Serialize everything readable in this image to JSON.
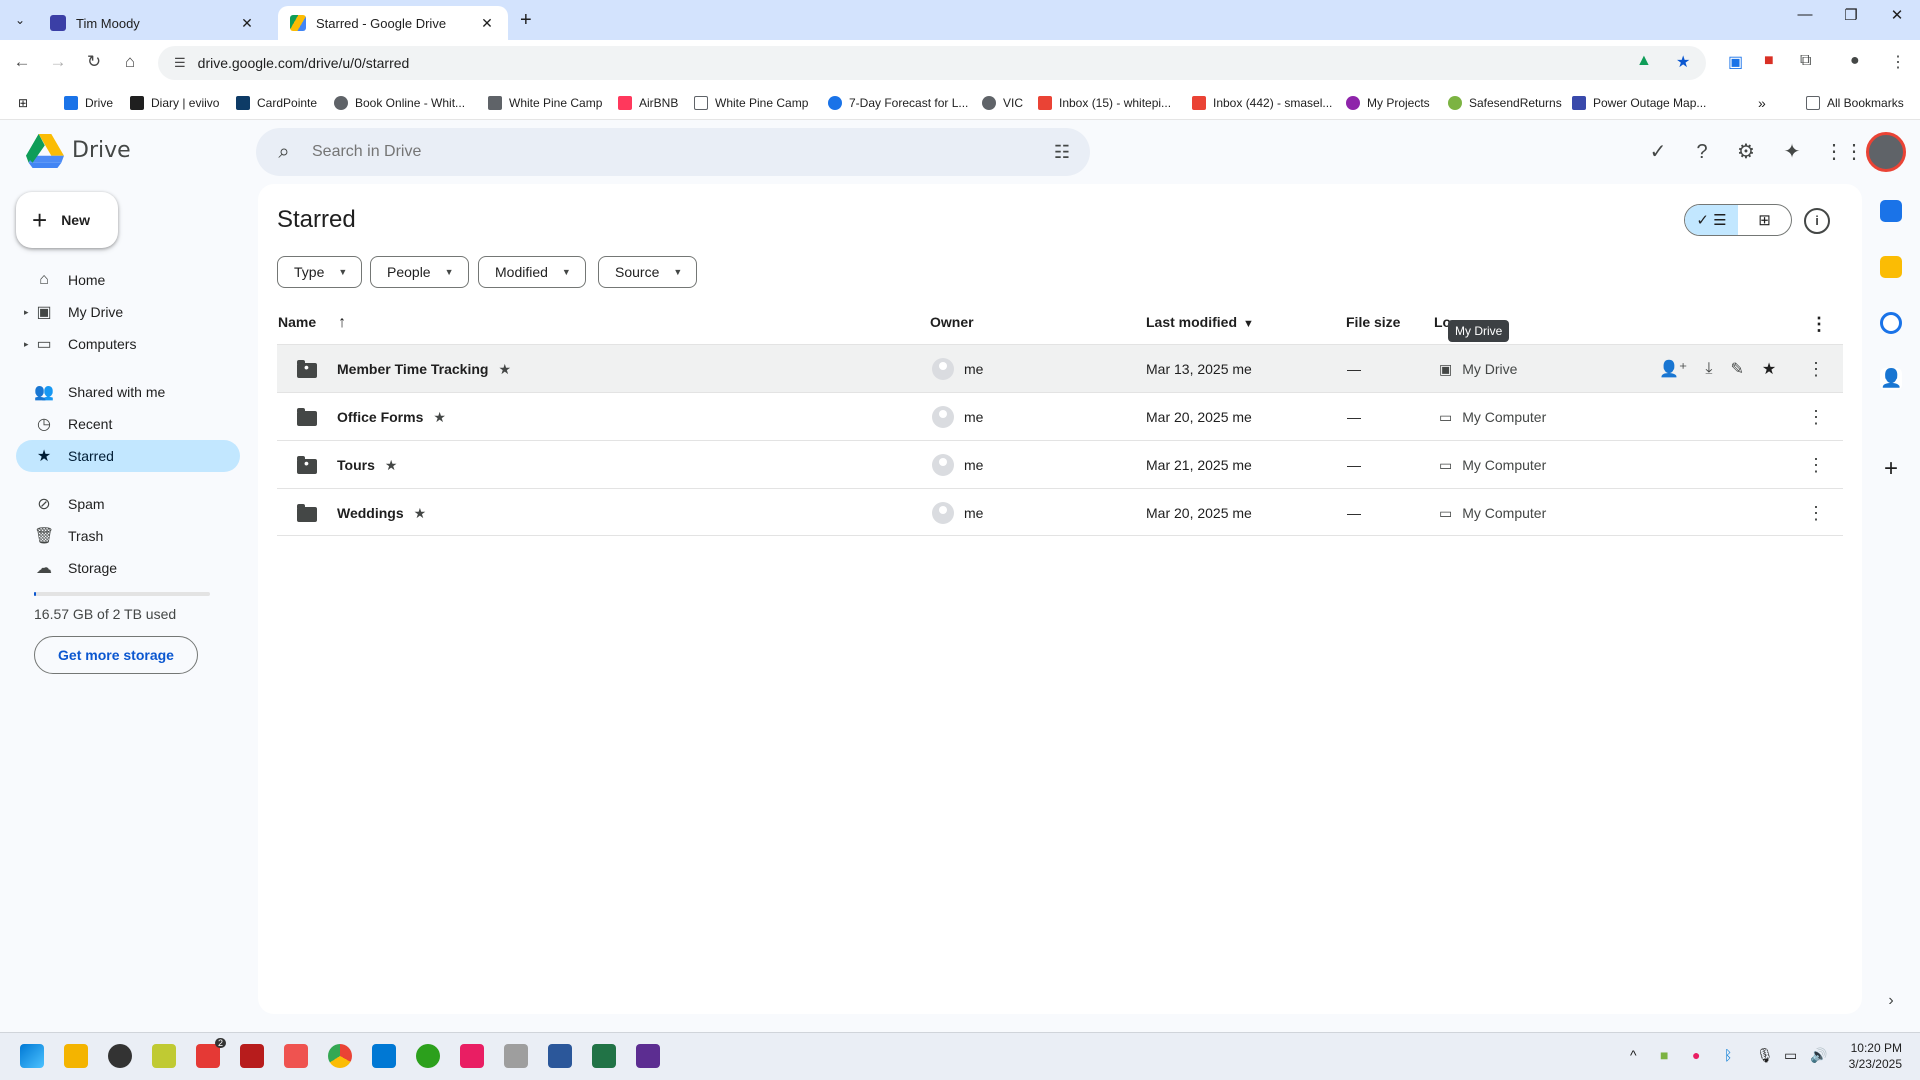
{
  "browser": {
    "tabs": [
      {
        "title": "Tim Moody",
        "icon": "forms-icon",
        "color": "#3b3fa6"
      },
      {
        "title": "Starred - Google Drive",
        "icon": "drive-icon",
        "color": "#1a73e8"
      }
    ],
    "url": "drive.google.com/drive/u/0/starred",
    "bookmarks": [
      {
        "label": "Drive",
        "color": "#1a73e8"
      },
      {
        "label": "Diary | eviivo",
        "color": "#1f1f1f"
      },
      {
        "label": "CardPointe",
        "color": "#0d3b66"
      },
      {
        "label": "Book Online - Whit...",
        "color": "#5f6368"
      },
      {
        "label": "White Pine Camp",
        "color": "#5f6368"
      },
      {
        "label": "AirBNB",
        "color": "#ff385c"
      },
      {
        "label": "White Pine Camp",
        "color": "#5f6368"
      },
      {
        "label": "7-Day Forecast for L...",
        "color": "#1a73e8"
      },
      {
        "label": "VIC",
        "color": "#5f6368"
      },
      {
        "label": "Inbox (15) - whitepi...",
        "color": "#ea4335"
      },
      {
        "label": "Inbox (442) - smasel...",
        "color": "#ea4335"
      },
      {
        "label": "My Projects",
        "color": "#8e24aa"
      },
      {
        "label": "SafesendReturns",
        "color": "#7cb342"
      },
      {
        "label": "Power Outage Map...",
        "color": "#3949ab"
      }
    ],
    "all_bookmarks": "All Bookmarks"
  },
  "drive": {
    "app_title": "Drive",
    "search_placeholder": "Search in Drive",
    "new_label": "New",
    "nav": [
      {
        "label": "Home",
        "icon": "home-icon"
      },
      {
        "label": "My Drive",
        "icon": "my-drive-icon"
      },
      {
        "label": "Computers",
        "icon": "computers-icon"
      },
      {
        "label": "Shared with me",
        "icon": "shared-icon"
      },
      {
        "label": "Recent",
        "icon": "clock-icon"
      },
      {
        "label": "Starred",
        "icon": "star-icon"
      },
      {
        "label": "Spam",
        "icon": "spam-icon"
      },
      {
        "label": "Trash",
        "icon": "trash-icon"
      },
      {
        "label": "Storage",
        "icon": "cloud-icon"
      }
    ],
    "storage_text": "16.57 GB of 2 TB used",
    "storage_fraction": 0.008,
    "get_more": "Get more storage",
    "page_title": "Starred",
    "filters": [
      "Type",
      "People",
      "Modified",
      "Source"
    ],
    "columns": {
      "name": "Name",
      "owner": "Owner",
      "modified": "Last modified",
      "size": "File size",
      "location": "Lo"
    },
    "tooltip": "My Drive",
    "rows": [
      {
        "name": "Member Time Tracking",
        "shared": true,
        "owner": "me",
        "modified": "Mar 13, 2025 me",
        "size": "—",
        "location": "My Drive",
        "loc_icon": "drive-icon"
      },
      {
        "name": "Office Forms",
        "shared": false,
        "owner": "me",
        "modified": "Mar 20, 2025 me",
        "size": "—",
        "location": "My Computer",
        "loc_icon": "laptop-icon"
      },
      {
        "name": "Tours",
        "shared": true,
        "owner": "me",
        "modified": "Mar 21, 2025 me",
        "size": "—",
        "location": "My Computer",
        "loc_icon": "laptop-icon"
      },
      {
        "name": "Weddings",
        "shared": false,
        "owner": "me",
        "modified": "Mar 20, 2025 me",
        "size": "—",
        "location": "My Computer",
        "loc_icon": "laptop-icon"
      }
    ]
  },
  "taskbar": {
    "time": "10:20 PM",
    "date": "3/23/2025",
    "badge": "2"
  }
}
